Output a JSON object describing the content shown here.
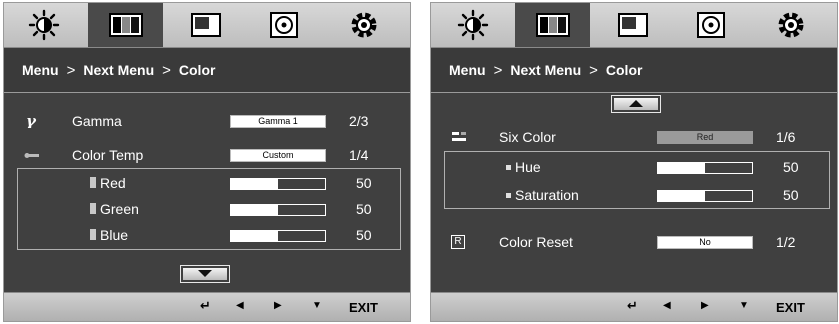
{
  "tabs": [
    {
      "icon": "brightness-icon",
      "active": false
    },
    {
      "icon": "picture-icon",
      "active": true
    },
    {
      "icon": "display-icon",
      "active": false
    },
    {
      "icon": "disc-icon",
      "active": false
    },
    {
      "icon": "settings-icon",
      "active": false
    }
  ],
  "breadcrumb": {
    "root": "Menu",
    "sep": ">",
    "mid": "Next Menu",
    "current": "Color"
  },
  "left": {
    "gamma": {
      "label": "Gamma",
      "value": "Gamma 1",
      "count": "2/3"
    },
    "color_temp": {
      "label": "Color Temp",
      "value": "Custom",
      "count": "1/4"
    },
    "red": {
      "label": "Red",
      "value": "50",
      "level": 0.5
    },
    "green": {
      "label": "Green",
      "value": "50",
      "level": 0.5
    },
    "blue": {
      "label": "Blue",
      "value": "50",
      "level": 0.5
    }
  },
  "right": {
    "six_color": {
      "label": "Six Color",
      "value": "Red",
      "count": "1/6"
    },
    "hue": {
      "label": "Hue",
      "value": "50",
      "level": 0.5
    },
    "saturation": {
      "label": "Saturation",
      "value": "50",
      "level": 0.5
    },
    "color_reset": {
      "label": "Color Reset",
      "value": "No",
      "count": "1/2",
      "icon_letter": "R"
    }
  },
  "bottom": {
    "exit_label": "EXIT"
  },
  "colors": {
    "panel": "#404040",
    "tab_active": "#4a4a4a",
    "frame": "#9a9a9a"
  }
}
